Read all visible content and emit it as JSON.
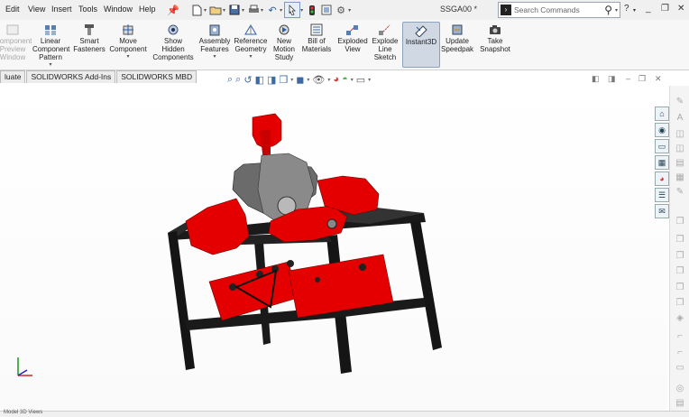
{
  "menu": [
    "Edit",
    "View",
    "Insert",
    "Tools",
    "Window",
    "Help"
  ],
  "quick_access": [
    "pin-icon",
    "new-document-icon",
    "open-icon",
    "save-icon",
    "print-icon",
    "undo-icon",
    "select-icon",
    "rebuild-icon",
    "file-properties-icon",
    "options-icon"
  ],
  "title": "SSGA00 *",
  "search": {
    "placeholder": "Search Commands"
  },
  "window_controls": {
    "help": "?",
    "minimize": "_",
    "restore": "❐",
    "close": "✕"
  },
  "ribbon": [
    {
      "label": "Component Preview Window",
      "icon": "component-preview-icon",
      "disabled": true
    },
    {
      "label": "Linear Component Pattern",
      "icon": "linear-pattern-icon"
    },
    {
      "label": "Smart Fasteners",
      "icon": "smart-fasteners-icon"
    },
    {
      "label": "Move Component",
      "icon": "move-component-icon"
    },
    {
      "label": "Show Hidden Components",
      "icon": "show-hidden-icon"
    },
    {
      "label": "Assembly Features",
      "icon": "assembly-features-icon"
    },
    {
      "label": "Reference Geometry",
      "icon": "reference-geometry-icon"
    },
    {
      "label": "New Motion Study",
      "icon": "motion-study-icon"
    },
    {
      "label": "Bill of Materials",
      "icon": "bom-icon"
    },
    {
      "label": "Exploded View",
      "icon": "exploded-view-icon"
    },
    {
      "label": "Explode Line Sketch",
      "icon": "explode-line-icon"
    },
    {
      "label": "Instant3D",
      "icon": "instant3d-icon",
      "active": true
    },
    {
      "label": "Update Speedpak",
      "icon": "speedpak-icon"
    },
    {
      "label": "Take Snapshot",
      "icon": "snapshot-icon"
    }
  ],
  "tabs": [
    "luate",
    "SOLIDWORKS Add-Ins",
    "SOLIDWORKS MBD"
  ],
  "statusbar": {
    "text": "Model  3D Views"
  },
  "colors": {
    "part_red": "#e40000",
    "frame_black": "#151515",
    "gray_part": "#7f7f7f",
    "instant3d_active": "#cfd8e3"
  }
}
